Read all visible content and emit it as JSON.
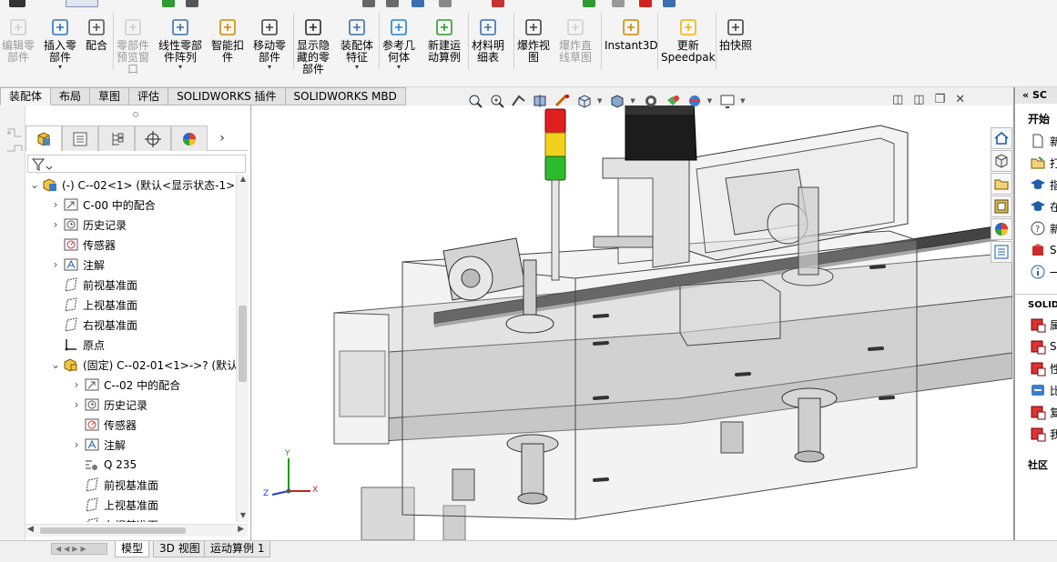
{
  "ribbon": {
    "tools": [
      {
        "id": "edit-component",
        "label": "编辑零\n部件",
        "disabled": true,
        "dropdown": false
      },
      {
        "id": "insert-components",
        "label": "插入零\n部件",
        "disabled": false,
        "dropdown": true
      },
      {
        "id": "mate",
        "label": "配合",
        "disabled": false,
        "dropdown": false
      },
      {
        "id": "component-preview",
        "label": "零部件\n预览窗\n口",
        "disabled": true,
        "dropdown": false
      },
      {
        "id": "linear-pattern",
        "label": "线性零部\n件阵列",
        "disabled": false,
        "dropdown": true
      },
      {
        "id": "smart-fasteners",
        "label": "智能扣\n件",
        "disabled": false,
        "dropdown": false
      },
      {
        "id": "move-component",
        "label": "移动零\n部件",
        "disabled": false,
        "dropdown": true
      },
      {
        "id": "show-hidden",
        "label": "显示隐\n藏的零\n部件",
        "disabled": false,
        "dropdown": false
      },
      {
        "id": "assembly-features",
        "label": "装配体\n特征",
        "disabled": false,
        "dropdown": true
      },
      {
        "id": "reference-geometry",
        "label": "参考几\n何体",
        "disabled": false,
        "dropdown": true
      },
      {
        "id": "new-motion-study",
        "label": "新建运\n动算例",
        "disabled": false,
        "dropdown": false
      },
      {
        "id": "bill-of-materials",
        "label": "材料明\n细表",
        "disabled": false,
        "dropdown": false
      },
      {
        "id": "exploded-view",
        "label": "爆炸视\n图",
        "disabled": false,
        "dropdown": false
      },
      {
        "id": "explode-line-sketch",
        "label": "爆炸直\n线草图",
        "disabled": true,
        "dropdown": false
      },
      {
        "id": "instant3d",
        "label": "Instant3D",
        "disabled": false,
        "dropdown": false
      },
      {
        "id": "update-speedpak",
        "label": "更新\nSpeedpak",
        "disabled": false,
        "dropdown": false
      },
      {
        "id": "take-snapshot",
        "label": "拍快照",
        "disabled": false,
        "dropdown": false
      }
    ]
  },
  "command_tabs": [
    "装配体",
    "布局",
    "草图",
    "评估",
    "SOLIDWORKS 插件",
    "SOLIDWORKS MBD"
  ],
  "active_command_tab": "装配体",
  "tree": {
    "rows": [
      {
        "level": 0,
        "expander": "down",
        "icon": "assembly-icon",
        "label": "(-) C--02<1> (默认<显示状态-1>"
      },
      {
        "level": 1,
        "expander": "right",
        "icon": "mates-folder-icon",
        "label": "C-00 中的配合"
      },
      {
        "level": 1,
        "expander": "right",
        "icon": "history-icon",
        "label": "历史记录"
      },
      {
        "level": 1,
        "expander": "none",
        "icon": "sensor-icon",
        "label": "传感器"
      },
      {
        "level": 1,
        "expander": "right",
        "icon": "annotation-icon",
        "label": "注解"
      },
      {
        "level": 1,
        "expander": "none",
        "icon": "plane-icon",
        "label": "前视基准面"
      },
      {
        "level": 1,
        "expander": "none",
        "icon": "plane-icon",
        "label": "上视基准面"
      },
      {
        "level": 1,
        "expander": "none",
        "icon": "plane-icon",
        "label": "右视基准面"
      },
      {
        "level": 1,
        "expander": "none",
        "icon": "origin-icon",
        "label": "原点"
      },
      {
        "level": 1,
        "expander": "down",
        "icon": "sub-assembly-icon",
        "label": "(固定) C--02-01<1>->? (默认"
      },
      {
        "level": 2,
        "expander": "right",
        "icon": "mates-folder-icon",
        "label": "C--02 中的配合"
      },
      {
        "level": 2,
        "expander": "right",
        "icon": "history-icon",
        "label": "历史记录"
      },
      {
        "level": 2,
        "expander": "none",
        "icon": "sensor-icon",
        "label": "传感器"
      },
      {
        "level": 2,
        "expander": "right",
        "icon": "annotation-icon",
        "label": "注解"
      },
      {
        "level": 2,
        "expander": "none",
        "icon": "material-icon",
        "label": "Q 235"
      },
      {
        "level": 2,
        "expander": "none",
        "icon": "plane-icon",
        "label": "前视基准面"
      },
      {
        "level": 2,
        "expander": "none",
        "icon": "plane-icon",
        "label": "上视基准面"
      },
      {
        "level": 2,
        "expander": "none",
        "icon": "plane-icon",
        "label": "右视基准面"
      }
    ]
  },
  "bottom_tabs": [
    "模型",
    "3D 视图",
    "运动算例 1"
  ],
  "active_bottom_tab": "模型",
  "task_pane": {
    "header": "SC",
    "section_start": "开始",
    "start_items": [
      {
        "icon": "new-document-icon",
        "label": "新"
      },
      {
        "icon": "open-folder-icon",
        "label": "打"
      },
      {
        "icon": "tutorial-cap-icon",
        "label": "指"
      },
      {
        "icon": "tutorial-cap-icon",
        "label": "在"
      },
      {
        "icon": "help-icon",
        "label": "新"
      },
      {
        "icon": "solidworks-box-icon",
        "label": "SO"
      },
      {
        "icon": "info-icon",
        "label": "一"
      }
    ],
    "section_resources": "SOLID",
    "resource_items": [
      {
        "icon": "sw-resource-icon",
        "label": "属"
      },
      {
        "icon": "sw-resource-icon",
        "label": "SO"
      },
      {
        "icon": "sw-resource-icon",
        "label": "性"
      },
      {
        "icon": "sw-compare-icon",
        "label": "比"
      },
      {
        "icon": "sw-resource-icon",
        "label": "复"
      },
      {
        "icon": "sw-resource-icon",
        "label": "我"
      }
    ],
    "section_community": "社区"
  },
  "triad": {
    "x": "X",
    "y": "Y",
    "z": "Z"
  },
  "colors": {
    "accent_blue": "#1f5fa8",
    "stack_light_red": "#e02020",
    "stack_light_yellow": "#f0d21e",
    "stack_light_green": "#2dbb2d",
    "motor_black": "#1c1c1c"
  }
}
